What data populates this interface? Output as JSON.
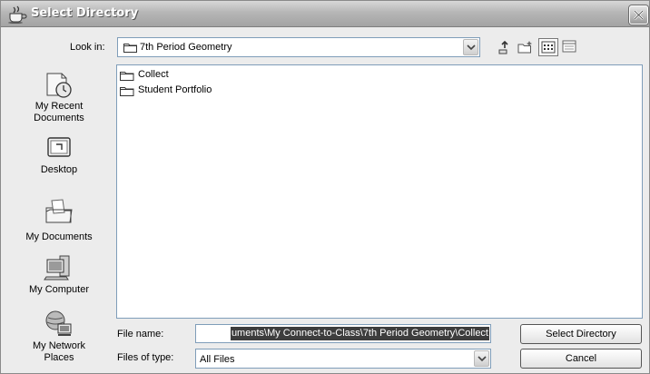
{
  "window": {
    "title": "Select Directory"
  },
  "toolbar": {
    "look_in_label": "Look in:",
    "look_in_value": "7th Period Geometry",
    "icons": [
      "up-one-level-icon",
      "create-new-folder-icon",
      "list-view-icon",
      "details-view-icon"
    ]
  },
  "places": [
    {
      "label_1": "My Recent",
      "label_2": "Documents",
      "icon": "recent-documents-icon"
    },
    {
      "label_1": "Desktop",
      "label_2": "",
      "icon": "desktop-icon"
    },
    {
      "label_1": "My Documents",
      "label_2": "",
      "icon": "my-documents-icon"
    },
    {
      "label_1": "My Computer",
      "label_2": "",
      "icon": "my-computer-icon"
    },
    {
      "label_1": "My Network",
      "label_2": "Places",
      "icon": "network-places-icon"
    }
  ],
  "files": [
    {
      "name": "Collect",
      "icon": "folder-icon"
    },
    {
      "name": "Student Portfolio",
      "icon": "folder-icon"
    }
  ],
  "file_name": {
    "label": "File name:",
    "value": "uments\\My Connect-to-Class\\7th Period Geometry\\Collect"
  },
  "file_type": {
    "label": "Files of type:",
    "value": "All Files"
  },
  "buttons": {
    "select": "Select Directory",
    "cancel": "Cancel"
  },
  "colors": {
    "selection": "#3d3d3d",
    "field_border": "#7f9db9",
    "dialog_bg": "#ececec"
  }
}
